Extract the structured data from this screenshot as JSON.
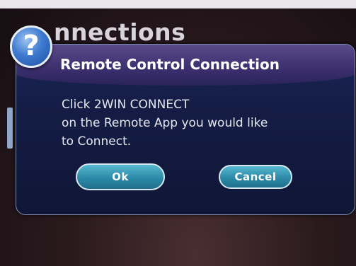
{
  "background": {
    "screen_title": "nnections"
  },
  "dialog": {
    "title": "Remote Control Connection",
    "icon": "question-mark-icon",
    "icon_glyph": "?",
    "message_lines": [
      "Click 2WIN CONNECT",
      "on the Remote App you would like",
      "to Connect."
    ],
    "buttons": {
      "ok_label": "Ok",
      "cancel_label": "Cancel"
    }
  },
  "colors": {
    "dialog_background": "#141d46",
    "header_gradient": "#3b2f6e",
    "button": "#2c8aa8",
    "help_icon": "#3d7ad0"
  }
}
